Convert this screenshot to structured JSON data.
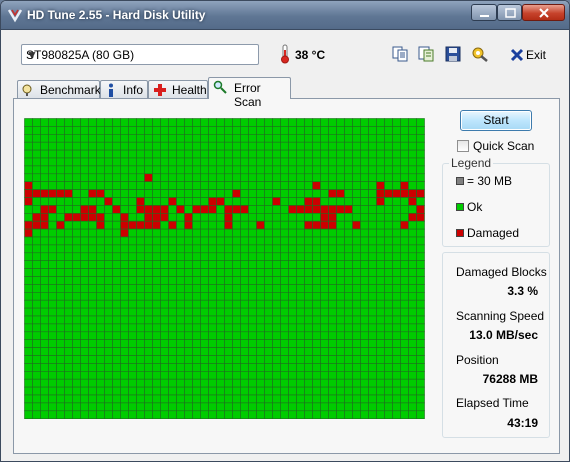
{
  "window": {
    "title": "HD Tune 2.55 - Hard Disk Utility"
  },
  "toolbar": {
    "drive": "ST980825A (80 GB)",
    "temperature": "38 °C",
    "icons": [
      "copy-text-icon",
      "copy-info-icon",
      "save-icon",
      "options-icon"
    ],
    "exit_label": "Exit"
  },
  "tabs": [
    {
      "label": "Benchmark",
      "icon": "benchmark-icon"
    },
    {
      "label": "Info",
      "icon": "info-icon"
    },
    {
      "label": "Health",
      "icon": "health-icon"
    },
    {
      "label": "Error Scan",
      "icon": "magnifier-icon",
      "active": true
    }
  ],
  "scan": {
    "start_label": "Start",
    "quick_scan_label": "Quick Scan",
    "quick_scan_checked": false
  },
  "legend": {
    "title": "Legend",
    "block_size": "= 30 MB",
    "ok": "Ok",
    "damaged": "Damaged",
    "colors": {
      "unscanned": "#808080",
      "ok": "#00cc00",
      "damaged": "#cc0000"
    }
  },
  "stats": {
    "damaged_blocks_label": "Damaged Blocks",
    "damaged_blocks_value": "3.3 %",
    "speed_label": "Scanning Speed",
    "speed_value": "13.0 MB/sec",
    "position_label": "Position",
    "position_value": "76288 MB",
    "elapsed_label": "Elapsed Time",
    "elapsed_value": "43:19"
  },
  "block_map": {
    "columns": 50,
    "rows": 38,
    "damaged": [
      [
        7,
        15
      ],
      [
        8,
        0
      ],
      [
        8,
        36
      ],
      [
        8,
        44
      ],
      [
        8,
        47
      ],
      [
        9,
        0
      ],
      [
        9,
        1
      ],
      [
        9,
        2
      ],
      [
        9,
        3
      ],
      [
        9,
        4
      ],
      [
        9,
        5
      ],
      [
        9,
        8
      ],
      [
        9,
        9
      ],
      [
        9,
        26
      ],
      [
        9,
        38
      ],
      [
        9,
        39
      ],
      [
        9,
        44
      ],
      [
        9,
        45
      ],
      [
        9,
        46
      ],
      [
        9,
        47
      ],
      [
        9,
        48
      ],
      [
        9,
        49
      ],
      [
        10,
        0
      ],
      [
        10,
        10
      ],
      [
        10,
        14
      ],
      [
        10,
        18
      ],
      [
        10,
        23
      ],
      [
        10,
        24
      ],
      [
        10,
        31
      ],
      [
        10,
        35
      ],
      [
        10,
        36
      ],
      [
        10,
        44
      ],
      [
        10,
        48
      ],
      [
        11,
        2
      ],
      [
        11,
        3
      ],
      [
        11,
        7
      ],
      [
        11,
        8
      ],
      [
        11,
        11
      ],
      [
        11,
        14
      ],
      [
        11,
        15
      ],
      [
        11,
        16
      ],
      [
        11,
        17
      ],
      [
        11,
        19
      ],
      [
        11,
        21
      ],
      [
        11,
        22
      ],
      [
        11,
        23
      ],
      [
        11,
        25
      ],
      [
        11,
        26
      ],
      [
        11,
        27
      ],
      [
        11,
        33
      ],
      [
        11,
        34
      ],
      [
        11,
        35
      ],
      [
        11,
        36
      ],
      [
        11,
        37
      ],
      [
        11,
        38
      ],
      [
        11,
        39
      ],
      [
        11,
        40
      ],
      [
        11,
        49
      ],
      [
        12,
        1
      ],
      [
        12,
        2
      ],
      [
        12,
        5
      ],
      [
        12,
        6
      ],
      [
        12,
        7
      ],
      [
        12,
        8
      ],
      [
        12,
        9
      ],
      [
        12,
        12
      ],
      [
        12,
        15
      ],
      [
        12,
        16
      ],
      [
        12,
        17
      ],
      [
        12,
        20
      ],
      [
        12,
        25
      ],
      [
        12,
        37
      ],
      [
        12,
        38
      ],
      [
        12,
        48
      ],
      [
        12,
        49
      ],
      [
        13,
        0
      ],
      [
        13,
        1
      ],
      [
        13,
        2
      ],
      [
        13,
        4
      ],
      [
        13,
        9
      ],
      [
        13,
        12
      ],
      [
        13,
        13
      ],
      [
        13,
        14
      ],
      [
        13,
        15
      ],
      [
        13,
        16
      ],
      [
        13,
        18
      ],
      [
        13,
        20
      ],
      [
        13,
        25
      ],
      [
        13,
        29
      ],
      [
        13,
        35
      ],
      [
        13,
        36
      ],
      [
        13,
        37
      ],
      [
        13,
        38
      ],
      [
        13,
        41
      ],
      [
        13,
        47
      ],
      [
        14,
        0
      ],
      [
        14,
        12
      ]
    ]
  }
}
